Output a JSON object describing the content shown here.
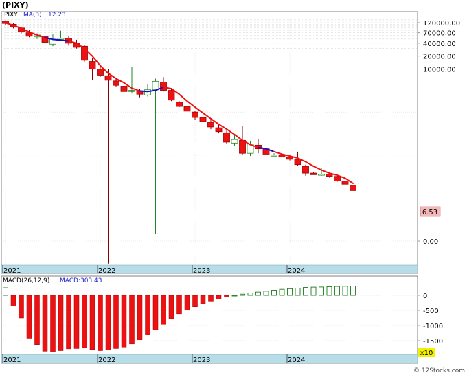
{
  "title": "(PIXY)",
  "watermark": "© 12Stocks.com",
  "colors": {
    "up": "#ffffff",
    "down": "#ee1111",
    "up_wick": "#228822",
    "down_wick": "#880000",
    "ma_up": "#1010cc",
    "ma_down": "#ee1111",
    "macd_hist": "#ee1111",
    "macd_pos_border": "#1a7a1a",
    "axis_band": "#b7dde8",
    "price_label_bg": "#f4b8b8",
    "multiplier_bg": "#f2f200"
  },
  "chart_data": [
    {
      "type": "candlestick",
      "panel": "price",
      "scale": "log",
      "legend": {
        "ticker": "PIXY",
        "ma_label": "MA(3)",
        "ma_value": "12.23"
      },
      "y_tick_labels": [
        "120000.00",
        "70000.00",
        "40000.00",
        "20000.00",
        "10000.00",
        "0.00"
      ],
      "y_tick_values": [
        120000,
        70000,
        40000,
        20000,
        10000,
        1
      ],
      "x_tick_labels": [
        "2021",
        "2022",
        "2023",
        "2024"
      ],
      "x_tick_months": [
        0,
        12,
        24,
        36
      ],
      "last_price_label": "6.53",
      "months": [
        0,
        1,
        2,
        3,
        4,
        5,
        6,
        7,
        8,
        9,
        10,
        11,
        12,
        13,
        14,
        15,
        16,
        17,
        18,
        19,
        20,
        21,
        22,
        23,
        24,
        25,
        26,
        27,
        28,
        29,
        30,
        31,
        32,
        33,
        34,
        35,
        36,
        37,
        38,
        39,
        40,
        41,
        42,
        43,
        44,
        45
      ],
      "ohlc": [
        [
          130000,
          135000,
          105000,
          115000
        ],
        [
          110000,
          118000,
          88000,
          96000
        ],
        [
          90000,
          97000,
          68000,
          74000
        ],
        [
          70000,
          80000,
          55000,
          58000
        ],
        [
          56000,
          68000,
          50000,
          62000
        ],
        [
          58000,
          64000,
          38000,
          42000
        ],
        [
          38000,
          64000,
          34000,
          52000
        ],
        [
          50000,
          78000,
          47000,
          52000
        ],
        [
          52000,
          60000,
          35000,
          40000
        ],
        [
          40000,
          48000,
          30000,
          32000
        ],
        [
          34000,
          36000,
          15000,
          16000
        ],
        [
          15000,
          18000,
          5500,
          10000
        ],
        [
          10000,
          12500,
          6600,
          7200
        ],
        [
          7000,
          10000,
          0.3,
          5500
        ],
        [
          5300,
          6200,
          3800,
          4200
        ],
        [
          4000,
          6700,
          2800,
          3000
        ],
        [
          3000,
          11000,
          2700,
          3200
        ],
        [
          3100,
          3500,
          2200,
          2600
        ],
        [
          2500,
          4500,
          2300,
          3300
        ],
        [
          3300,
          6000,
          1.5,
          5200
        ],
        [
          5000,
          6500,
          3000,
          3200
        ],
        [
          3200,
          3400,
          1800,
          1900
        ],
        [
          1700,
          1800,
          1300,
          1350
        ],
        [
          1350,
          1450,
          1000,
          1050
        ],
        [
          1000,
          1050,
          650,
          750
        ],
        [
          750,
          830,
          550,
          600
        ],
        [
          580,
          650,
          400,
          450
        ],
        [
          430,
          530,
          320,
          350
        ],
        [
          330,
          370,
          180,
          200
        ],
        [
          190,
          300,
          160,
          230
        ],
        [
          220,
          480,
          100,
          110
        ],
        [
          110,
          210,
          95,
          180
        ],
        [
          170,
          240,
          110,
          140
        ],
        [
          140,
          170,
          100,
          105
        ],
        [
          100,
          110,
          95,
          100
        ],
        [
          100,
          110,
          85,
          90
        ],
        [
          90,
          100,
          75,
          80
        ],
        [
          80,
          120,
          55,
          60
        ],
        [
          55,
          60,
          33,
          38
        ],
        [
          38,
          40,
          35,
          35
        ],
        [
          36,
          50,
          33,
          36
        ],
        [
          36,
          40,
          30,
          32
        ],
        [
          32,
          33,
          24,
          25
        ],
        [
          25,
          27,
          20,
          21
        ],
        [
          20,
          20,
          15,
          15
        ]
      ],
      "ma": [
        118000,
        104000,
        88000,
        73000,
        62000,
        54000,
        49000,
        47000,
        45000,
        40000,
        30000,
        20000,
        12000,
        8000,
        6000,
        4800,
        3600,
        3100,
        3000,
        3200,
        3800,
        3500,
        2600,
        1800,
        1300,
        950,
        700,
        520,
        400,
        300,
        220,
        175,
        150,
        140,
        120,
        105,
        95,
        85,
        70,
        55,
        45,
        38,
        34,
        29,
        22
      ],
      "ma_colors": [
        "down",
        "down",
        "down",
        "down",
        "down",
        "down",
        "up",
        "up",
        "up",
        "down",
        "down",
        "down",
        "down",
        "down",
        "down",
        "down",
        "down",
        "down",
        "up",
        "up",
        "up",
        "down",
        "down",
        "down",
        "down",
        "down",
        "down",
        "down",
        "down",
        "down",
        "down",
        "down",
        "down",
        "up",
        "up",
        "down",
        "down",
        "down",
        "down",
        "down",
        "down",
        "down",
        "down",
        "down",
        "down"
      ]
    },
    {
      "type": "bar",
      "panel": "macd",
      "legend": {
        "label": "MACD(26,12,9)",
        "value_label": "MACD:303.43"
      },
      "multiplier_label": "x10",
      "y_tick_labels": [
        "0",
        "-500",
        "-1000",
        "-1500"
      ],
      "y_tick_values": [
        0,
        -500,
        -1000,
        -1500
      ],
      "x_tick_labels": [
        "2021",
        "2022",
        "2023",
        "2024"
      ],
      "months": [
        0,
        1,
        2,
        3,
        4,
        5,
        6,
        7,
        8,
        9,
        10,
        11,
        12,
        13,
        14,
        15,
        16,
        17,
        18,
        19,
        20,
        21,
        22,
        23,
        24,
        25,
        26,
        27,
        28,
        29,
        30,
        31,
        32,
        33,
        34,
        35,
        36,
        37,
        38,
        39,
        40,
        41,
        42,
        43,
        44,
        45
      ],
      "values": [
        250,
        -350,
        -750,
        -1420,
        -1630,
        -1850,
        -1880,
        -1830,
        -1770,
        -1760,
        -1730,
        -1790,
        -1830,
        -1800,
        -1760,
        -1710,
        -1610,
        -1470,
        -1310,
        -1140,
        -960,
        -770,
        -610,
        -490,
        -380,
        -270,
        -190,
        -120,
        -60,
        0,
        40,
        80,
        110,
        140,
        170,
        200,
        220,
        240,
        260,
        270,
        275,
        285,
        295,
        300,
        305
      ]
    }
  ]
}
